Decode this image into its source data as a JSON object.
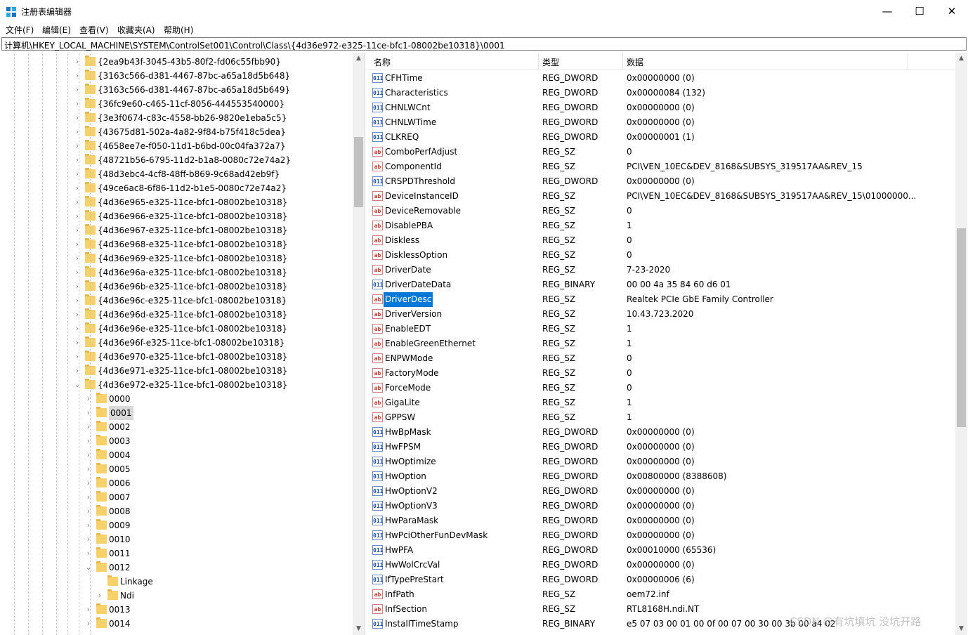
{
  "window": {
    "title": "注册表编辑器",
    "minimize_glyph": "—",
    "maximize_glyph": "☐",
    "close_glyph": "✕"
  },
  "menu": [
    "文件(F)",
    "编辑(E)",
    "查看(V)",
    "收藏夹(A)",
    "帮助(H)"
  ],
  "address": "计算机\\HKEY_LOCAL_MACHINE\\SYSTEM\\ControlSet001\\Control\\Class\\{4d36e972-e325-11ce-bfc1-08002be10318}\\0001",
  "tree": {
    "level1": [
      {
        "label": "{2ea9b43f-3045-43b5-80f2-fd06c55fbb90}",
        "expanded": false
      },
      {
        "label": "{3163c566-d381-4467-87bc-a65a18d5b648}",
        "expanded": false
      },
      {
        "label": "{3163c566-d381-4467-87bc-a65a18d5b649}",
        "expanded": false
      },
      {
        "label": "{36fc9e60-c465-11cf-8056-444553540000}",
        "expanded": false
      },
      {
        "label": "{3e3f0674-c83c-4558-bb26-9820e1eba5c5}",
        "expanded": false
      },
      {
        "label": "{43675d81-502a-4a82-9f84-b75f418c5dea}",
        "expanded": false
      },
      {
        "label": "{4658ee7e-f050-11d1-b6bd-00c04fa372a7}",
        "expanded": false
      },
      {
        "label": "{48721b56-6795-11d2-b1a8-0080c72e74a2}",
        "expanded": false
      },
      {
        "label": "{48d3ebc4-4cf8-48ff-b869-9c68ad42eb9f}",
        "expanded": false
      },
      {
        "label": "{49ce6ac8-6f86-11d2-b1e5-0080c72e74a2}",
        "expanded": false
      },
      {
        "label": "{4d36e965-e325-11ce-bfc1-08002be10318}",
        "expanded": false
      },
      {
        "label": "{4d36e966-e325-11ce-bfc1-08002be10318}",
        "expanded": false
      },
      {
        "label": "{4d36e967-e325-11ce-bfc1-08002be10318}",
        "expanded": false
      },
      {
        "label": "{4d36e968-e325-11ce-bfc1-08002be10318}",
        "expanded": false
      },
      {
        "label": "{4d36e969-e325-11ce-bfc1-08002be10318}",
        "expanded": false
      },
      {
        "label": "{4d36e96a-e325-11ce-bfc1-08002be10318}",
        "expanded": false
      },
      {
        "label": "{4d36e96b-e325-11ce-bfc1-08002be10318}",
        "expanded": false
      },
      {
        "label": "{4d36e96c-e325-11ce-bfc1-08002be10318}",
        "expanded": false
      },
      {
        "label": "{4d36e96d-e325-11ce-bfc1-08002be10318}",
        "expanded": false
      },
      {
        "label": "{4d36e96e-e325-11ce-bfc1-08002be10318}",
        "expanded": false
      },
      {
        "label": "{4d36e96f-e325-11ce-bfc1-08002be10318}",
        "expanded": false
      },
      {
        "label": "{4d36e970-e325-11ce-bfc1-08002be10318}",
        "expanded": false
      },
      {
        "label": "{4d36e971-e325-11ce-bfc1-08002be10318}",
        "expanded": false
      },
      {
        "label": "{4d36e972-e325-11ce-bfc1-08002be10318}",
        "expanded": true
      }
    ],
    "level2": [
      {
        "label": "0000",
        "expanded": false,
        "selected": false
      },
      {
        "label": "0001",
        "expanded": false,
        "selected": true
      },
      {
        "label": "0002",
        "expanded": false,
        "selected": false
      },
      {
        "label": "0003",
        "expanded": false,
        "selected": false
      },
      {
        "label": "0004",
        "expanded": false,
        "selected": false
      },
      {
        "label": "0005",
        "expanded": false,
        "selected": false
      },
      {
        "label": "0006",
        "expanded": false,
        "selected": false
      },
      {
        "label": "0007",
        "expanded": false,
        "selected": false
      },
      {
        "label": "0008",
        "expanded": false,
        "selected": false
      },
      {
        "label": "0009",
        "expanded": false,
        "selected": false
      },
      {
        "label": "0010",
        "expanded": false,
        "selected": false
      },
      {
        "label": "0011",
        "expanded": false,
        "selected": false
      },
      {
        "label": "0012",
        "expanded": true,
        "selected": false
      }
    ],
    "level3": [
      {
        "label": "Linkage",
        "has_children": false
      },
      {
        "label": "Ndi",
        "has_children": true
      }
    ],
    "level2_after": [
      {
        "label": "0013"
      },
      {
        "label": "0014"
      }
    ]
  },
  "values": {
    "headers": {
      "name": "名称",
      "type": "类型",
      "data": "数据"
    },
    "rows": [
      {
        "name": "CFHTime",
        "type": "REG_DWORD",
        "data": "0x00000000 (0)",
        "icon": "bin"
      },
      {
        "name": "Characteristics",
        "type": "REG_DWORD",
        "data": "0x00000084 (132)",
        "icon": "bin"
      },
      {
        "name": "CHNLWCnt",
        "type": "REG_DWORD",
        "data": "0x00000000 (0)",
        "icon": "bin"
      },
      {
        "name": "CHNLWTime",
        "type": "REG_DWORD",
        "data": "0x00000000 (0)",
        "icon": "bin"
      },
      {
        "name": "CLKREQ",
        "type": "REG_DWORD",
        "data": "0x00000001 (1)",
        "icon": "bin"
      },
      {
        "name": "ComboPerfAdjust",
        "type": "REG_SZ",
        "data": "0",
        "icon": "sz"
      },
      {
        "name": "ComponentId",
        "type": "REG_SZ",
        "data": "PCI\\VEN_10EC&DEV_8168&SUBSYS_319517AA&REV_15",
        "icon": "sz"
      },
      {
        "name": "CRSPDThreshold",
        "type": "REG_DWORD",
        "data": "0x00000000 (0)",
        "icon": "bin"
      },
      {
        "name": "DeviceInstanceID",
        "type": "REG_SZ",
        "data": "PCI\\VEN_10EC&DEV_8168&SUBSYS_319517AA&REV_15\\01000000...",
        "icon": "sz"
      },
      {
        "name": "DeviceRemovable",
        "type": "REG_SZ",
        "data": "0",
        "icon": "sz"
      },
      {
        "name": "DisablePBA",
        "type": "REG_SZ",
        "data": "1",
        "icon": "sz"
      },
      {
        "name": "Diskless",
        "type": "REG_SZ",
        "data": "0",
        "icon": "sz"
      },
      {
        "name": "DisklessOption",
        "type": "REG_SZ",
        "data": "0",
        "icon": "sz"
      },
      {
        "name": "DriverDate",
        "type": "REG_SZ",
        "data": "7-23-2020",
        "icon": "sz"
      },
      {
        "name": "DriverDateData",
        "type": "REG_BINARY",
        "data": "00 00 4a 35 84 60 d6 01",
        "icon": "bin"
      },
      {
        "name": "DriverDesc",
        "type": "REG_SZ",
        "data": "Realtek PCIe GbE Family Controller",
        "icon": "sz",
        "selected": true
      },
      {
        "name": "DriverVersion",
        "type": "REG_SZ",
        "data": "10.43.723.2020",
        "icon": "sz"
      },
      {
        "name": "EnableEDT",
        "type": "REG_SZ",
        "data": "1",
        "icon": "sz"
      },
      {
        "name": "EnableGreenEthernet",
        "type": "REG_SZ",
        "data": "1",
        "icon": "sz"
      },
      {
        "name": "ENPWMode",
        "type": "REG_SZ",
        "data": "0",
        "icon": "sz"
      },
      {
        "name": "FactoryMode",
        "type": "REG_SZ",
        "data": "0",
        "icon": "sz"
      },
      {
        "name": "ForceMode",
        "type": "REG_SZ",
        "data": "0",
        "icon": "sz"
      },
      {
        "name": "GigaLite",
        "type": "REG_SZ",
        "data": "1",
        "icon": "sz"
      },
      {
        "name": "GPPSW",
        "type": "REG_SZ",
        "data": "1",
        "icon": "sz"
      },
      {
        "name": "HwBpMask",
        "type": "REG_DWORD",
        "data": "0x00000000 (0)",
        "icon": "bin"
      },
      {
        "name": "HwFPSM",
        "type": "REG_DWORD",
        "data": "0x00000000 (0)",
        "icon": "bin"
      },
      {
        "name": "HwOptimize",
        "type": "REG_DWORD",
        "data": "0x00000000 (0)",
        "icon": "bin"
      },
      {
        "name": "HwOption",
        "type": "REG_DWORD",
        "data": "0x00800000 (8388608)",
        "icon": "bin"
      },
      {
        "name": "HwOptionV2",
        "type": "REG_DWORD",
        "data": "0x00000000 (0)",
        "icon": "bin"
      },
      {
        "name": "HwOptionV3",
        "type": "REG_DWORD",
        "data": "0x00000000 (0)",
        "icon": "bin"
      },
      {
        "name": "HwParaMask",
        "type": "REG_DWORD",
        "data": "0x00000000 (0)",
        "icon": "bin"
      },
      {
        "name": "HwPciOtherFunDevMask",
        "type": "REG_DWORD",
        "data": "0x00000000 (0)",
        "icon": "bin"
      },
      {
        "name": "HwPFA",
        "type": "REG_DWORD",
        "data": "0x00010000 (65536)",
        "icon": "bin"
      },
      {
        "name": "HwWolCrcVal",
        "type": "REG_DWORD",
        "data": "0x00000000 (0)",
        "icon": "bin"
      },
      {
        "name": "IfTypePreStart",
        "type": "REG_DWORD",
        "data": "0x00000006 (6)",
        "icon": "bin"
      },
      {
        "name": "InfPath",
        "type": "REG_SZ",
        "data": "oem72.inf",
        "icon": "sz"
      },
      {
        "name": "InfSection",
        "type": "REG_SZ",
        "data": "RTL8168H.ndi.NT",
        "icon": "sz"
      },
      {
        "name": "InstallTimeStamp",
        "type": "REG_BINARY",
        "data": "e5 07 03 00 01 00 0f 00 07 00 30 00 3b 00 a4 02",
        "icon": "bin"
      }
    ]
  },
  "icon_glyphs": {
    "sz": "ab",
    "bin": "011"
  },
  "watermark": "CSDN @有坑填坑 没坑开路"
}
